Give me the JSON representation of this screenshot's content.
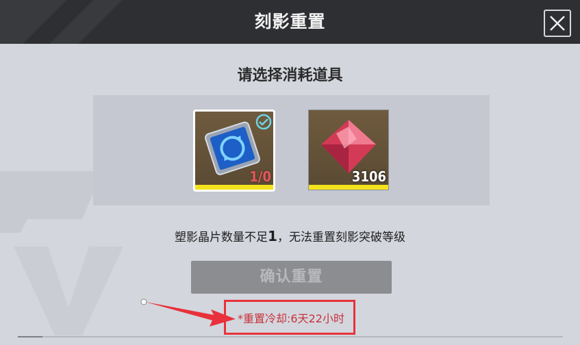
{
  "header": {
    "title": "刻影重置",
    "close_icon": "close-icon"
  },
  "main": {
    "subtitle": "请选择消耗道具",
    "items": [
      {
        "name": "reset-card",
        "icon": "card-refresh-icon",
        "count": "1/0",
        "selected": true,
        "count_color": "#e6575c"
      },
      {
        "name": "crystal",
        "icon": "red-crystal-icon",
        "count": "3106",
        "selected": false,
        "count_color": "#ffffff"
      }
    ],
    "message_prefix": "塑影晶片数量不足",
    "message_num": "1",
    "message_suffix": "，无法重置刻影突破等级",
    "confirm_label": "确认重置",
    "cooldown": "*重置冷却:6天22小时"
  },
  "colors": {
    "header_bg": "#2e2f33",
    "panel_bg": "#d3d6dd",
    "accent_yellow": "#f3e21d",
    "highlight_red": "#e8313b"
  }
}
